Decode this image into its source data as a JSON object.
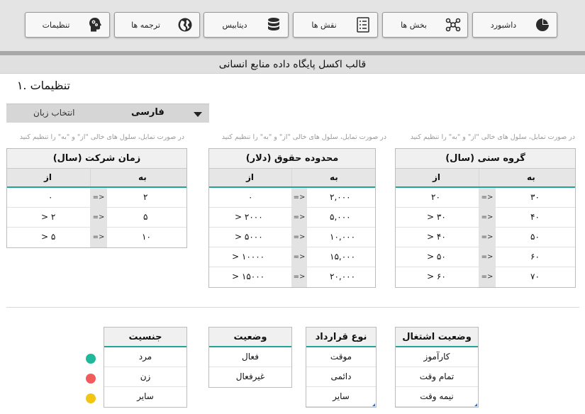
{
  "nav": {
    "buttons": [
      {
        "label": "داشبورد",
        "icon": "pie-chart-icon"
      },
      {
        "label": "بخش ها",
        "icon": "network-icon"
      },
      {
        "label": "نقش ها",
        "icon": "checklist-icon"
      },
      {
        "label": "دیتابیس",
        "icon": "database-icon"
      },
      {
        "label": "ترجمه ها",
        "icon": "globe-icon"
      },
      {
        "label": "تنظیمات",
        "icon": "head-gears-icon"
      }
    ]
  },
  "page_title": "قالب اکسل پایگاه داده منابع انسانی",
  "section_title": "تنظیمات .۱",
  "language": {
    "label": "انتخاب زبان",
    "value": "فارسی"
  },
  "note_text": "در صورت تمایل، سلول های خالی \"از\" و \"به\" را تنظیم کنید",
  "age_table": {
    "title": "گروه سنی (سال)",
    "to_label": "به",
    "from_label": "از",
    "rows": [
      {
        "from": "۲۰",
        "op": "=>",
        "to": "۳۰"
      },
      {
        "from": "> ۳۰",
        "op": "=>",
        "to": "۴۰"
      },
      {
        "from": "> ۴۰",
        "op": "=>",
        "to": "۵۰"
      },
      {
        "from": "> ۵۰",
        "op": "=>",
        "to": "۶۰"
      },
      {
        "from": "> ۶۰",
        "op": "=>",
        "to": "۷۰"
      }
    ]
  },
  "salary_table": {
    "title": "محدوده حقوق (دلار)",
    "to_label": "به",
    "from_label": "از",
    "rows": [
      {
        "from": "۰",
        "op": "=>",
        "to": "۲,۰۰۰"
      },
      {
        "from": "> ۲۰۰۰",
        "op": "=>",
        "to": "۵,۰۰۰"
      },
      {
        "from": "> ۵۰۰۰",
        "op": "=>",
        "to": "۱۰,۰۰۰"
      },
      {
        "from": "> ۱۰۰۰۰",
        "op": "=>",
        "to": "۱۵,۰۰۰"
      },
      {
        "from": "> ۱۵۰۰۰",
        "op": "=>",
        "to": "۲۰,۰۰۰"
      }
    ]
  },
  "tenure_table": {
    "title": "زمان شرکت (سال)",
    "to_label": "به",
    "from_label": "از",
    "rows": [
      {
        "from": "۰",
        "op": "=>",
        "to": "۲"
      },
      {
        "from": "> ۲",
        "op": "=>",
        "to": "۵"
      },
      {
        "from": "> ۵",
        "op": "=>",
        "to": "۱۰"
      }
    ]
  },
  "employment_status": {
    "title": "وضعیت اشتغال",
    "items": [
      "کارآموز",
      "تمام وقت",
      "نیمه وقت"
    ]
  },
  "contract_type": {
    "title": "نوع قرارداد",
    "items": [
      "موقت",
      "دائمی",
      "سایر"
    ]
  },
  "status": {
    "title": "وضعیت",
    "items": [
      "فعال",
      "غیرفعال"
    ]
  },
  "gender": {
    "title": "جنسیت",
    "items": [
      "مرد",
      "زن",
      "سایر"
    ]
  },
  "colors": {
    "accent": "#1fa59a",
    "male": "#1fb89a",
    "female": "#f25b5b",
    "other": "#f2c513"
  }
}
